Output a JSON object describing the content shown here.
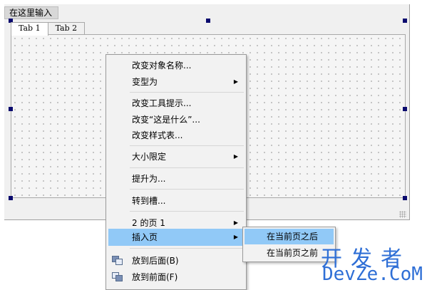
{
  "form": {
    "type_here": "在这里输入",
    "tabs": [
      "Tab 1",
      "Tab 2"
    ]
  },
  "menu": {
    "items": [
      {
        "label": "改变对象名称..."
      },
      {
        "label": "变型为",
        "submenu": true
      },
      {
        "label": "改变工具提示..."
      },
      {
        "label": "改变“这是什么”..."
      },
      {
        "label": "改变样式表..."
      },
      {
        "label": "大小限定",
        "submenu": true
      },
      {
        "label": "提升为..."
      },
      {
        "label": "转到槽..."
      },
      {
        "label": "2 的页 1",
        "submenu": true
      },
      {
        "label": "插入页",
        "submenu": true,
        "highlighted": true
      },
      {
        "label": "放到后面(B)",
        "icon": "send-to-back-icon"
      },
      {
        "label": "放到前面(F)",
        "icon": "bring-to-front-icon"
      }
    ],
    "arrow": "▶"
  },
  "submenu": {
    "items": [
      {
        "label": "在当前页之后",
        "highlighted": true
      },
      {
        "label": "在当前页之前"
      }
    ]
  },
  "watermark": {
    "cn": "开发者",
    "en": "DevZe.CoM"
  },
  "colors": {
    "highlight": "#91c9f7",
    "handle": "#0a0a6e",
    "watermark": "#2f6fd6"
  }
}
